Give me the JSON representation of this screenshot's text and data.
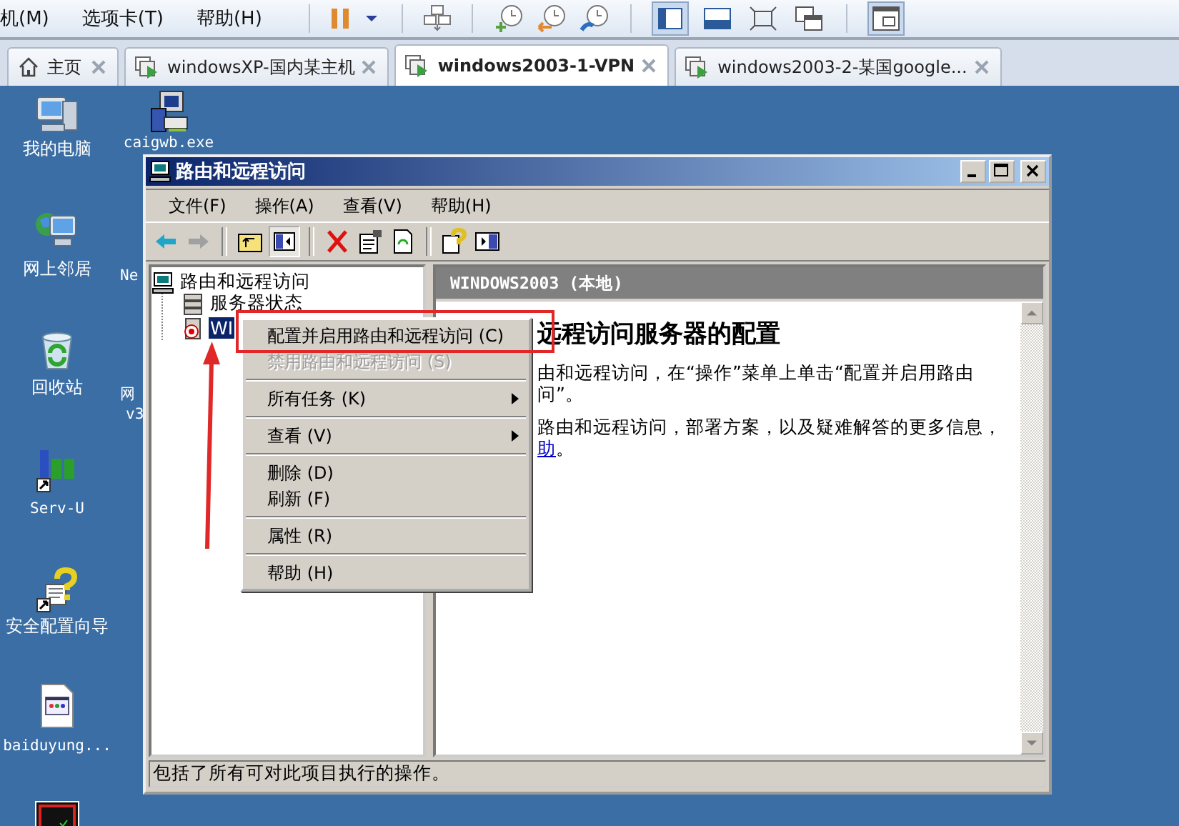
{
  "host_menu": [
    {
      "label": "机(M)"
    },
    {
      "label": "选项卡(T)"
    },
    {
      "label": "帮助(H)"
    }
  ],
  "tabs": [
    {
      "label": "主页",
      "kind": "home",
      "selected": false
    },
    {
      "label": "windowsXP-国内某主机",
      "kind": "vm",
      "selected": false
    },
    {
      "label": "windows2003-1-VPN",
      "kind": "vm",
      "selected": true
    },
    {
      "label": "windows2003-2-某国google...",
      "kind": "vm",
      "selected": false
    }
  ],
  "desktop_icons": [
    {
      "label": "我的电脑",
      "kind": "computer"
    },
    {
      "label": "caigwb.exe",
      "kind": "exe"
    },
    {
      "label": "网上邻居",
      "kind": "network"
    },
    {
      "label": "Ne",
      "kind": "covered"
    },
    {
      "label": "回收站",
      "kind": "recycle"
    },
    {
      "label": "网",
      "kind": "covered"
    },
    {
      "label": "v3",
      "kind": "covered"
    },
    {
      "label": "Serv-U",
      "kind": "servu"
    },
    {
      "label": "安全配置向导",
      "kind": "wizard"
    },
    {
      "label": "baiduyung...",
      "kind": "webpage"
    },
    {
      "kind": "app"
    }
  ],
  "window": {
    "title": "路由和远程访问",
    "menu": [
      {
        "label": "文件(F)"
      },
      {
        "label": "操作(A)"
      },
      {
        "label": "查看(V)"
      },
      {
        "label": "帮助(H)"
      }
    ],
    "tree": {
      "label": "路由和远程访问",
      "kind": "root",
      "selected": false,
      "children": [
        {
          "label": "服务器状态",
          "kind": "status",
          "selected": false
        },
        {
          "label": "WI",
          "kind": "server",
          "selected": true
        }
      ]
    },
    "pane_header": "WINDOWS2003 (本地)",
    "heading": "远程访问服务器的配置",
    "lines": [
      {
        "text": "由和远程访问，在“操作”菜单上单击“配置并启用路由"
      },
      {
        "text": "问”。"
      },
      {
        "text": "路由和远程访问，部署方案，以及疑难解答的更多信息，"
      },
      {
        "link": "助",
        "text": "。"
      }
    ],
    "status_bar": "包括了所有可对此项目执行的操作。"
  },
  "context_menu": {
    "groups": [
      {
        "items": [
          {
            "label": "配置并启用路由和远程访问 (C)",
            "disabled": false,
            "submenu": false
          },
          {
            "label": "禁用路由和远程访问 (S)",
            "disabled": true,
            "submenu": false
          }
        ]
      },
      {
        "items": [
          {
            "label": "所有任务 (K)",
            "disabled": false,
            "submenu": true
          }
        ]
      },
      {
        "items": [
          {
            "label": "查看 (V)",
            "disabled": false,
            "submenu": true
          }
        ]
      },
      {
        "items": [
          {
            "label": "删除 (D)",
            "disabled": false,
            "submenu": false
          },
          {
            "label": "刷新 (F)",
            "disabled": false,
            "submenu": false
          }
        ]
      },
      {
        "items": [
          {
            "label": "属性 (R)",
            "disabled": false,
            "submenu": false
          }
        ]
      },
      {
        "items": [
          {
            "label": "帮助 (H)",
            "disabled": false,
            "submenu": false
          }
        ]
      }
    ]
  },
  "annotations": [
    {
      "kind": "box"
    },
    {
      "kind": "arrow"
    }
  ]
}
